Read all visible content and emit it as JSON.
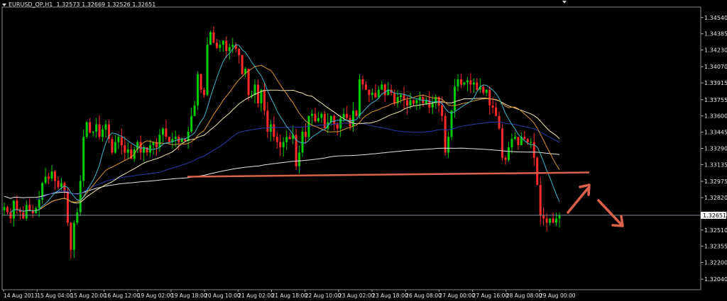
{
  "header": {
    "symbol": "EURUSD_OP,H1",
    "ohlc": "1.32573 1.32669 1.32526 1.32651"
  },
  "chart_data": {
    "type": "candlestick",
    "title": "EURUSD_OP,H1",
    "ylim": [
      1.3194,
      1.3464
    ],
    "y_ticks": [
      "1.34540",
      "1.34385",
      "1.34230",
      "1.34070",
      "1.33915",
      "1.33755",
      "1.33600",
      "1.33445",
      "1.33290",
      "1.33135",
      "1.32975",
      "1.32820",
      "1.32665",
      "1.32510",
      "1.32355",
      "1.32200",
      "1.32040"
    ],
    "x_ticks": [
      "14 Aug 2013",
      "15 Aug 04:00",
      "15 Aug 20:00",
      "16 Aug 12:00",
      "19 Aug 02:00",
      "19 Aug 18:00",
      "20 Aug 10:00",
      "21 Aug 02:00",
      "21 Aug 18:00",
      "22 Aug 10:00",
      "23 Aug 02:00",
      "23 Aug 18:00",
      "26 Aug 08:00",
      "27 Aug 00:00",
      "27 Aug 16:00",
      "28 Aug 08:00",
      "29 Aug 00:00"
    ],
    "current_price": "1.32651",
    "colors": {
      "background": "#000000",
      "bull": "#00cc00",
      "bear": "#ff2a2a",
      "grid": "#7f7f7f",
      "ma_cyan": "#3fb6c8",
      "ma_orange": "#d9962f",
      "ma_cream": "#f2e8b0",
      "ma_navy": "#2a3aa8",
      "ma_white": "#e6e6e6",
      "annotation": "#d9604a"
    },
    "support_level": 1.3306,
    "closes": [
      1.3273,
      1.3268,
      1.3262,
      1.3279,
      1.327,
      1.3268,
      1.3262,
      1.3275,
      1.327,
      1.3267,
      1.3272,
      1.328,
      1.3296,
      1.3302,
      1.33,
      1.3307,
      1.3298,
      1.3292,
      1.3296,
      1.3288,
      1.3258,
      1.3232,
      1.3258,
      1.3268,
      1.3298,
      1.334,
      1.3354,
      1.3344,
      1.3345,
      1.3352,
      1.334,
      1.3347,
      1.3352,
      1.3338,
      1.3325,
      1.3335,
      1.334,
      1.3332,
      1.3325,
      1.3328,
      1.3319,
      1.3328,
      1.3335,
      1.3325,
      1.333,
      1.3325,
      1.3332,
      1.3335,
      1.333,
      1.3342,
      1.3348,
      1.334,
      1.3335,
      1.3338,
      1.334,
      1.3335,
      1.3338,
      1.3336,
      1.3345,
      1.336,
      1.337,
      1.34,
      1.3385,
      1.338,
      1.3428,
      1.344,
      1.343,
      1.3425,
      1.3428,
      1.3432,
      1.3422,
      1.3426,
      1.3428,
      1.3424,
      1.3418,
      1.34,
      1.3405,
      1.338,
      1.338,
      1.339,
      1.3372,
      1.3385,
      1.3365,
      1.3345,
      1.3352,
      1.334,
      1.3335,
      1.333,
      1.3335,
      1.334,
      1.3338,
      1.3342,
      1.3312,
      1.3325,
      1.3345,
      1.334,
      1.336,
      1.3362,
      1.3355,
      1.3358,
      1.3362,
      1.3348,
      1.3354,
      1.336,
      1.3352,
      1.3348,
      1.3358,
      1.3362,
      1.3358,
      1.335,
      1.3365,
      1.336,
      1.3395,
      1.339,
      1.3385,
      1.338,
      1.3382,
      1.3378,
      1.3385,
      1.339,
      1.338,
      1.3385,
      1.3382,
      1.3372,
      1.3378,
      1.338,
      1.3375,
      1.337,
      1.3375,
      1.3372,
      1.3375,
      1.3378,
      1.3372,
      1.3375,
      1.3368,
      1.3372,
      1.3378,
      1.337,
      1.336,
      1.3325,
      1.334,
      1.3365,
      1.3388,
      1.3395,
      1.339,
      1.3392,
      1.3394,
      1.339,
      1.3392,
      1.3385,
      1.3388,
      1.3382,
      1.3385,
      1.337,
      1.3368,
      1.336,
      1.3348,
      1.332,
      1.3318,
      1.333,
      1.3338,
      1.334,
      1.3332,
      1.334,
      1.3338,
      1.3335,
      1.3335,
      1.332,
      1.3294,
      1.3265,
      1.3262,
      1.3258,
      1.3262,
      1.3258,
      1.3262,
      1.3265
    ]
  },
  "annotations": {
    "horizontal_line": "support",
    "arrows": [
      "arrow-up-icon",
      "arrow-down-icon"
    ]
  }
}
